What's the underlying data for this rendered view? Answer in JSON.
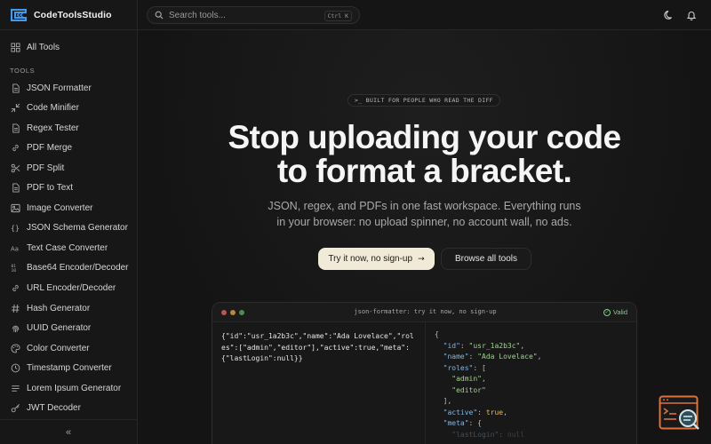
{
  "app": {
    "name": "CodeToolsStudio"
  },
  "sidebar": {
    "all_tools": "All Tools",
    "section_label": "TOOLS",
    "items": [
      {
        "label": "JSON Formatter",
        "icon": "file-icon"
      },
      {
        "label": "Code Minifier",
        "icon": "minimize-icon"
      },
      {
        "label": "Regex Tester",
        "icon": "file-icon"
      },
      {
        "label": "PDF Merge",
        "icon": "link-icon"
      },
      {
        "label": "PDF Split",
        "icon": "scissors-icon"
      },
      {
        "label": "PDF to Text",
        "icon": "file-icon"
      },
      {
        "label": "Image Converter",
        "icon": "image-icon"
      },
      {
        "label": "JSON Schema Generator",
        "icon": "braces-icon"
      },
      {
        "label": "Text Case Converter",
        "icon": "text-case-icon"
      },
      {
        "label": "Base64 Encoder/Decoder",
        "icon": "binary-icon"
      },
      {
        "label": "URL Encoder/Decoder",
        "icon": "link-icon"
      },
      {
        "label": "Hash Generator",
        "icon": "hash-icon"
      },
      {
        "label": "UUID Generator",
        "icon": "fingerprint-icon"
      },
      {
        "label": "Color Converter",
        "icon": "palette-icon"
      },
      {
        "label": "Timestamp Converter",
        "icon": "clock-icon"
      },
      {
        "label": "Lorem Ipsum Generator",
        "icon": "lines-icon"
      },
      {
        "label": "JWT Decoder",
        "icon": "key-icon"
      }
    ],
    "collapse": "«"
  },
  "topbar": {
    "search_placeholder": "Search tools...",
    "shortcut": "Ctrl K"
  },
  "hero": {
    "badge": ">_ BUILT FOR PEOPLE WHO READ THE DIFF",
    "headline_line1": "Stop uploading your code",
    "headline_line2": "to format a bracket.",
    "sub_line1": "JSON, regex, and PDFs in one fast workspace. Everything runs",
    "sub_line2": "in your browser: no upload spinner, no account wall, no ads.",
    "primary_cta": "Try it now, no sign-up",
    "primary_cta_arrow": "→",
    "secondary_cta": "Browse all tools"
  },
  "demo": {
    "title": "json-formatter: try it now, no sign-up",
    "status": "Valid",
    "input": "{\"id\":\"usr_1a2b3c\",\"name\":\"Ada Lovelace\",\"roles\":[\"admin\",\"editor\"],\"active\":true,\"meta\":{\"lastLogin\":null}}",
    "output": {
      "l1": "{",
      "id_key": "\"id\"",
      "id_val": "\"usr_1a2b3c\"",
      "name_key": "\"name\"",
      "name_val": "\"Ada Lovelace\"",
      "roles_key": "\"roles\"",
      "role1": "\"admin\"",
      "role2": "\"editor\"",
      "active_key": "\"active\"",
      "active_val": "true",
      "meta_key": "\"meta\"",
      "last_key": "\"lastLogin\"",
      "last_val": "null"
    }
  },
  "colors": {
    "accent": "#f1ead8",
    "valid": "#7fcf8e",
    "brand": "#3b82f6",
    "widget": "#e0703a"
  }
}
